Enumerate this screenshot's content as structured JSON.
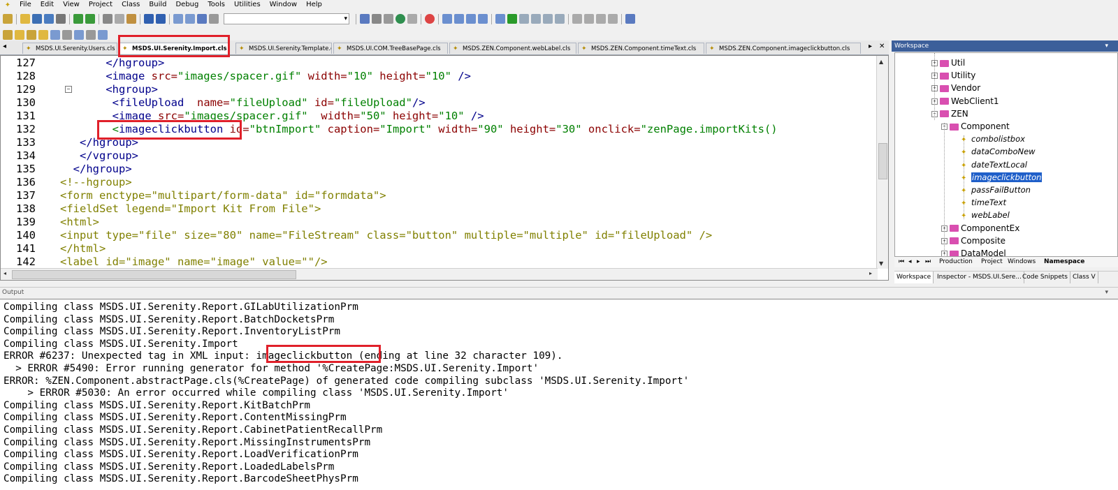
{
  "menu": [
    "File",
    "Edit",
    "View",
    "Project",
    "Class",
    "Build",
    "Debug",
    "Tools",
    "Utilities",
    "Window",
    "Help"
  ],
  "tabs": [
    {
      "label": "MSDS.UI.Serenity.Users.cls"
    },
    {
      "label": "MSDS.UI.Serenity.Import.cls",
      "active": true
    },
    {
      "label": "MSDS.UI.Serenity.Template.cls"
    },
    {
      "label": "MSDS.UI.COM.TreeBasePage.cls"
    },
    {
      "label": "MSDS.ZEN.Component.webLabel.cls"
    },
    {
      "label": "MSDS.ZEN.Component.timeText.cls"
    },
    {
      "label": "MSDS.ZEN.Component.imageclickbutton.cls"
    }
  ],
  "editor": {
    "lines": [
      {
        "num": "127",
        "indent": "       ",
        "parts": [
          [
            "t",
            "</hgroup>"
          ]
        ]
      },
      {
        "num": "128",
        "indent": "       ",
        "parts": [
          [
            "t",
            "<image "
          ],
          [
            "a",
            "src="
          ],
          [
            "v",
            "\"images/spacer.gif\""
          ],
          [
            "a",
            " width="
          ],
          [
            "v",
            "\"10\""
          ],
          [
            "a",
            " height="
          ],
          [
            "v",
            "\"10\""
          ],
          [
            "t",
            " />"
          ]
        ]
      },
      {
        "num": "129",
        "indent": "       ",
        "parts": [
          [
            "t",
            "<hgroup>"
          ]
        ]
      },
      {
        "num": "130",
        "indent": "        ",
        "parts": [
          [
            "t",
            "<fileUpload  "
          ],
          [
            "a",
            "name="
          ],
          [
            "v",
            "\"fileUpload\""
          ],
          [
            "a",
            " id="
          ],
          [
            "v",
            "\"fileUpload\""
          ],
          [
            "t",
            "/>"
          ]
        ]
      },
      {
        "num": "131",
        "indent": "        ",
        "parts": [
          [
            "t",
            "<image "
          ],
          [
            "a",
            "src="
          ],
          [
            "v",
            "\"images/spacer.gif\""
          ],
          [
            "a",
            "  width="
          ],
          [
            "v",
            "\"50\""
          ],
          [
            "a",
            " height="
          ],
          [
            "v",
            "\"10\""
          ],
          [
            "t",
            " />"
          ]
        ]
      },
      {
        "num": "132",
        "indent": "        ",
        "parts": [
          [
            "v",
            "<"
          ],
          [
            "t",
            "imageclickbutton "
          ],
          [
            "a",
            "id="
          ],
          [
            "v",
            "\"btnImport\""
          ],
          [
            "a",
            " caption="
          ],
          [
            "v",
            "\"Import\""
          ],
          [
            "a",
            " width="
          ],
          [
            "v",
            "\"90\""
          ],
          [
            "a",
            " height="
          ],
          [
            "v",
            "\"30\""
          ],
          [
            "a",
            " onclick="
          ],
          [
            "v",
            "\"zenPage.importKits()"
          ]
        ]
      },
      {
        "num": "133",
        "indent": "   ",
        "parts": [
          [
            "t",
            "</hgroup>"
          ]
        ]
      },
      {
        "num": "134",
        "indent": "   ",
        "parts": [
          [
            "t",
            "</vgroup>"
          ]
        ]
      },
      {
        "num": "135",
        "indent": "  ",
        "parts": [
          [
            "t",
            "</hgroup>"
          ]
        ]
      },
      {
        "num": "136",
        "indent": "",
        "parts": [
          [
            "c",
            "<!--hgroup>"
          ]
        ]
      },
      {
        "num": "137",
        "indent": "",
        "parts": [
          [
            "c",
            "<form enctype=\"multipart/form-data\" id=\"formdata\">"
          ]
        ]
      },
      {
        "num": "138",
        "indent": "",
        "parts": [
          [
            "c",
            "<fieldSet legend=\"Import Kit From File\">"
          ]
        ]
      },
      {
        "num": "139",
        "indent": "",
        "parts": [
          [
            "c",
            "<html>"
          ]
        ]
      },
      {
        "num": "140",
        "indent": "",
        "parts": [
          [
            "c",
            "<input type=\"file\" size=\"80\" name=\"FileStream\" class=\"button\" multiple=\"multiple\" id=\"fileUpload\" />"
          ]
        ]
      },
      {
        "num": "141",
        "indent": "",
        "parts": [
          [
            "c",
            "</html>"
          ]
        ]
      },
      {
        "num": "142",
        "indent": "",
        "parts": [
          [
            "c",
            "<label id=\"image\" name=\"image\" value=\"\"/>"
          ]
        ]
      }
    ]
  },
  "workspace": {
    "title": "Workspace",
    "tree": [
      {
        "label": "Util",
        "kind": "folder",
        "level": 1
      },
      {
        "label": "Utility",
        "kind": "folder",
        "level": 1
      },
      {
        "label": "Vendor",
        "kind": "folder",
        "level": 1
      },
      {
        "label": "WebClient1",
        "kind": "folder",
        "level": 1
      },
      {
        "label": "ZEN",
        "kind": "folder",
        "level": 1,
        "open": true
      },
      {
        "label": "Component",
        "kind": "folder",
        "level": 2,
        "open": true
      },
      {
        "label": "combolistbox",
        "kind": "class",
        "level": 3
      },
      {
        "label": "dataComboNew",
        "kind": "class",
        "level": 3
      },
      {
        "label": "dateTextLocal",
        "kind": "class",
        "level": 3
      },
      {
        "label": "imageclickbutton",
        "kind": "class",
        "level": 3,
        "selected": true
      },
      {
        "label": "passFailButton",
        "kind": "class",
        "level": 3
      },
      {
        "label": "timeText",
        "kind": "class",
        "level": 3
      },
      {
        "label": "webLabel",
        "kind": "class",
        "level": 3
      },
      {
        "label": "ComponentEx",
        "kind": "folder",
        "level": 2
      },
      {
        "label": "Composite",
        "kind": "folder",
        "level": 2
      },
      {
        "label": "DataModel",
        "kind": "folder",
        "level": 2
      }
    ],
    "bottom_tabs": [
      "Production",
      "Project",
      "Windows",
      "Namespace"
    ],
    "panel_tabs": [
      "Workspace",
      "Inspector - MSDS.UI.Sere...",
      "Code Snippets",
      "Class V"
    ]
  },
  "output": {
    "title": "Output",
    "lines": [
      "Compiling class MSDS.UI.Serenity.Report.GILabUtilizationPrm",
      "Compiling class MSDS.UI.Serenity.Report.BatchDocketsPrm",
      "Compiling class MSDS.UI.Serenity.Report.InventoryListPrm",
      "Compiling class MSDS.UI.Serenity.Import",
      "ERROR #6237: Unexpected tag in XML input: imageclickbutton (ending at line 32 character 109).",
      "  > ERROR #5490: Error running generator for method '%CreatePage:MSDS.UI.Serenity.Import'",
      "ERROR: %ZEN.Component.abstractPage.cls(%CreatePage) of generated code compiling subclass 'MSDS.UI.Serenity.Import'",
      "    > ERROR #5030: An error occurred while compiling class 'MSDS.UI.Serenity.Import'",
      "Compiling class MSDS.UI.Serenity.Report.KitBatchPrm",
      "Compiling class MSDS.UI.Serenity.Report.ContentMissingPrm",
      "Compiling class MSDS.UI.Serenity.Report.CabinetPatientRecallPrm",
      "Compiling class MSDS.UI.Serenity.Report.MissingInstrumentsPrm",
      "Compiling class MSDS.UI.Serenity.Report.LoadVerificationPrm",
      "Compiling class MSDS.UI.Serenity.Report.LoadedLabelsPrm",
      "Compiling class MSDS.UI.Serenity.Report.BarcodeSheetPhysPrm"
    ]
  },
  "colors": {
    "highlight": "#e0202a",
    "selection": "#1f5fc9",
    "tag": "#00008b",
    "attr": "#8b0000",
    "value": "#008000",
    "comment": "#808000"
  }
}
